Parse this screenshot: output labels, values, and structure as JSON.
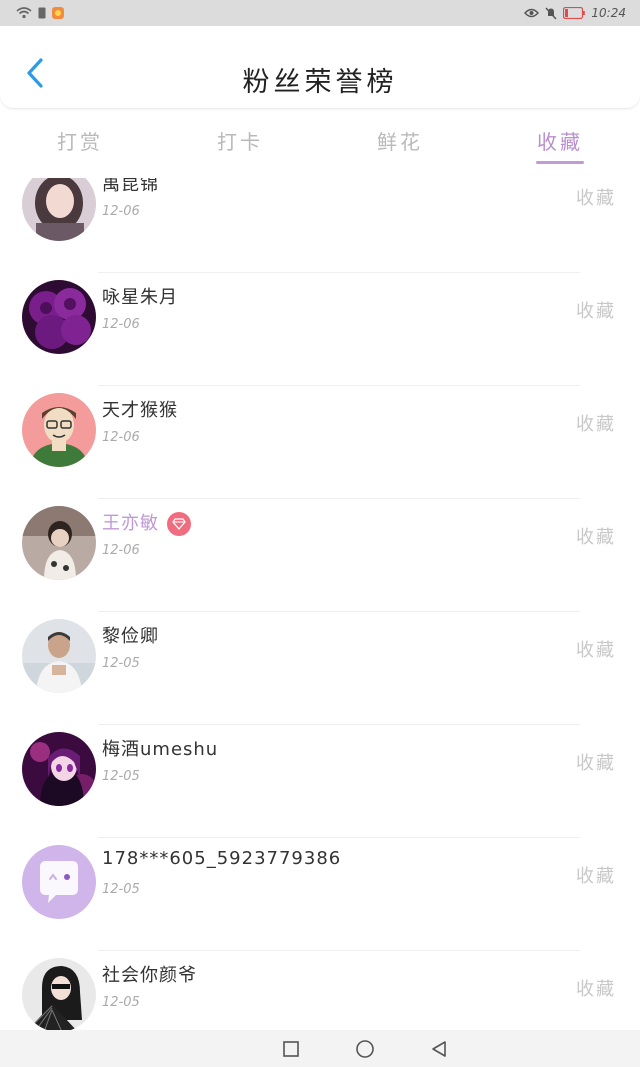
{
  "status_bar": {
    "time": "10:24"
  },
  "header": {
    "title": "粉丝荣誉榜",
    "back_icon": "chevron-left-icon"
  },
  "tabs": [
    {
      "label": "打赏",
      "active": false
    },
    {
      "label": "打卡",
      "active": false
    },
    {
      "label": "鲜花",
      "active": false
    },
    {
      "label": "收藏",
      "active": true
    }
  ],
  "colors": {
    "accent": "#c19ad6",
    "back": "#2b9be8",
    "badge": "#f06c7f"
  },
  "list": [
    {
      "name": "禹昆锦",
      "date": "12-06",
      "action": "收藏",
      "vip": false,
      "avatar": "girl-portrait"
    },
    {
      "name": "咏星朱月",
      "date": "12-06",
      "action": "收藏",
      "vip": false,
      "avatar": "purple-roses"
    },
    {
      "name": "天才猴猴",
      "date": "12-06",
      "action": "收藏",
      "vip": false,
      "avatar": "cartoon-man"
    },
    {
      "name": "王亦敏",
      "date": "12-06",
      "action": "收藏",
      "vip": true,
      "avatar": "child-photo"
    },
    {
      "name": "黎俭卿",
      "date": "12-05",
      "action": "收藏",
      "vip": false,
      "avatar": "man-photo"
    },
    {
      "name": "梅酒umeshu",
      "date": "12-05",
      "action": "收藏",
      "vip": false,
      "avatar": "anime-girl"
    },
    {
      "name": "178***605_5923779386",
      "date": "12-05",
      "action": "收藏",
      "vip": false,
      "avatar": "default-chat"
    },
    {
      "name": "社会你颜爷",
      "date": "12-05",
      "action": "收藏",
      "vip": false,
      "avatar": "woman-fan"
    }
  ],
  "nav": [
    "recent-apps",
    "home",
    "back"
  ]
}
